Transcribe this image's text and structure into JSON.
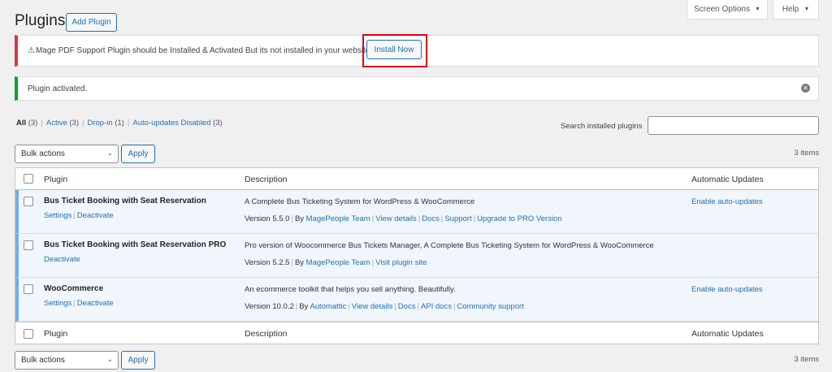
{
  "header": {
    "title": "Plugins",
    "add_plugin": "Add Plugin",
    "screen_options": "Screen Options",
    "help": "Help"
  },
  "notices": {
    "error_text": "Mage PDF Support Plugin should be Installed & Activated But its not installed in your website",
    "install_now": "Install Now",
    "success_text": "Plugin activated."
  },
  "filters": [
    {
      "label": "All",
      "count": "(3)",
      "current": true
    },
    {
      "label": "Active",
      "count": "(3)"
    },
    {
      "label": "Drop-in",
      "count": "(1)"
    },
    {
      "label": "Auto-updates Disabled",
      "count": "(3)"
    }
  ],
  "search": {
    "label": "Search installed plugins",
    "value": ""
  },
  "bulk": {
    "label": "Bulk actions",
    "apply": "Apply",
    "items_count": "3 items"
  },
  "columns": {
    "plugin": "Plugin",
    "description": "Description",
    "auto_updates": "Automatic Updates"
  },
  "plugins": [
    {
      "name": "Bus Ticket Booking with Seat Reservation",
      "actions": [
        "Settings",
        "Deactivate"
      ],
      "description": "A Complete Bus Ticketing System for WordPress & WooCommerce",
      "version": "Version 5.5.0",
      "by": "By",
      "author": "MagePeople Team",
      "links": [
        "View details",
        "Docs",
        "Support",
        "Upgrade to PRO Version"
      ],
      "auto_update": "Enable auto-updates"
    },
    {
      "name": "Bus Ticket Booking with Seat Reservation PRO",
      "actions": [
        "Deactivate"
      ],
      "description": "Pro version of Woocommerce Bus Tickets Manager, A Complete Bus Ticketing System for WordPress & WooCommerce",
      "version": "Version 5.2.5",
      "by": "By",
      "author": "MagePeople Team",
      "links": [
        "Visit plugin site"
      ],
      "auto_update": ""
    },
    {
      "name": "WooCommerce",
      "actions": [
        "Settings",
        "Deactivate"
      ],
      "description": "An ecommerce toolkit that helps you sell anything. Beautifully.",
      "version": "Version 10.0.2",
      "by": "By",
      "author": "Automattic",
      "links": [
        "View details",
        "Docs",
        "API docs",
        "Community support"
      ],
      "auto_update": "Enable auto-updates"
    }
  ],
  "colors": {
    "accent": "#2271b1",
    "error": "#d63638",
    "success": "#00a32a",
    "active_row": "#f0f6fc"
  }
}
